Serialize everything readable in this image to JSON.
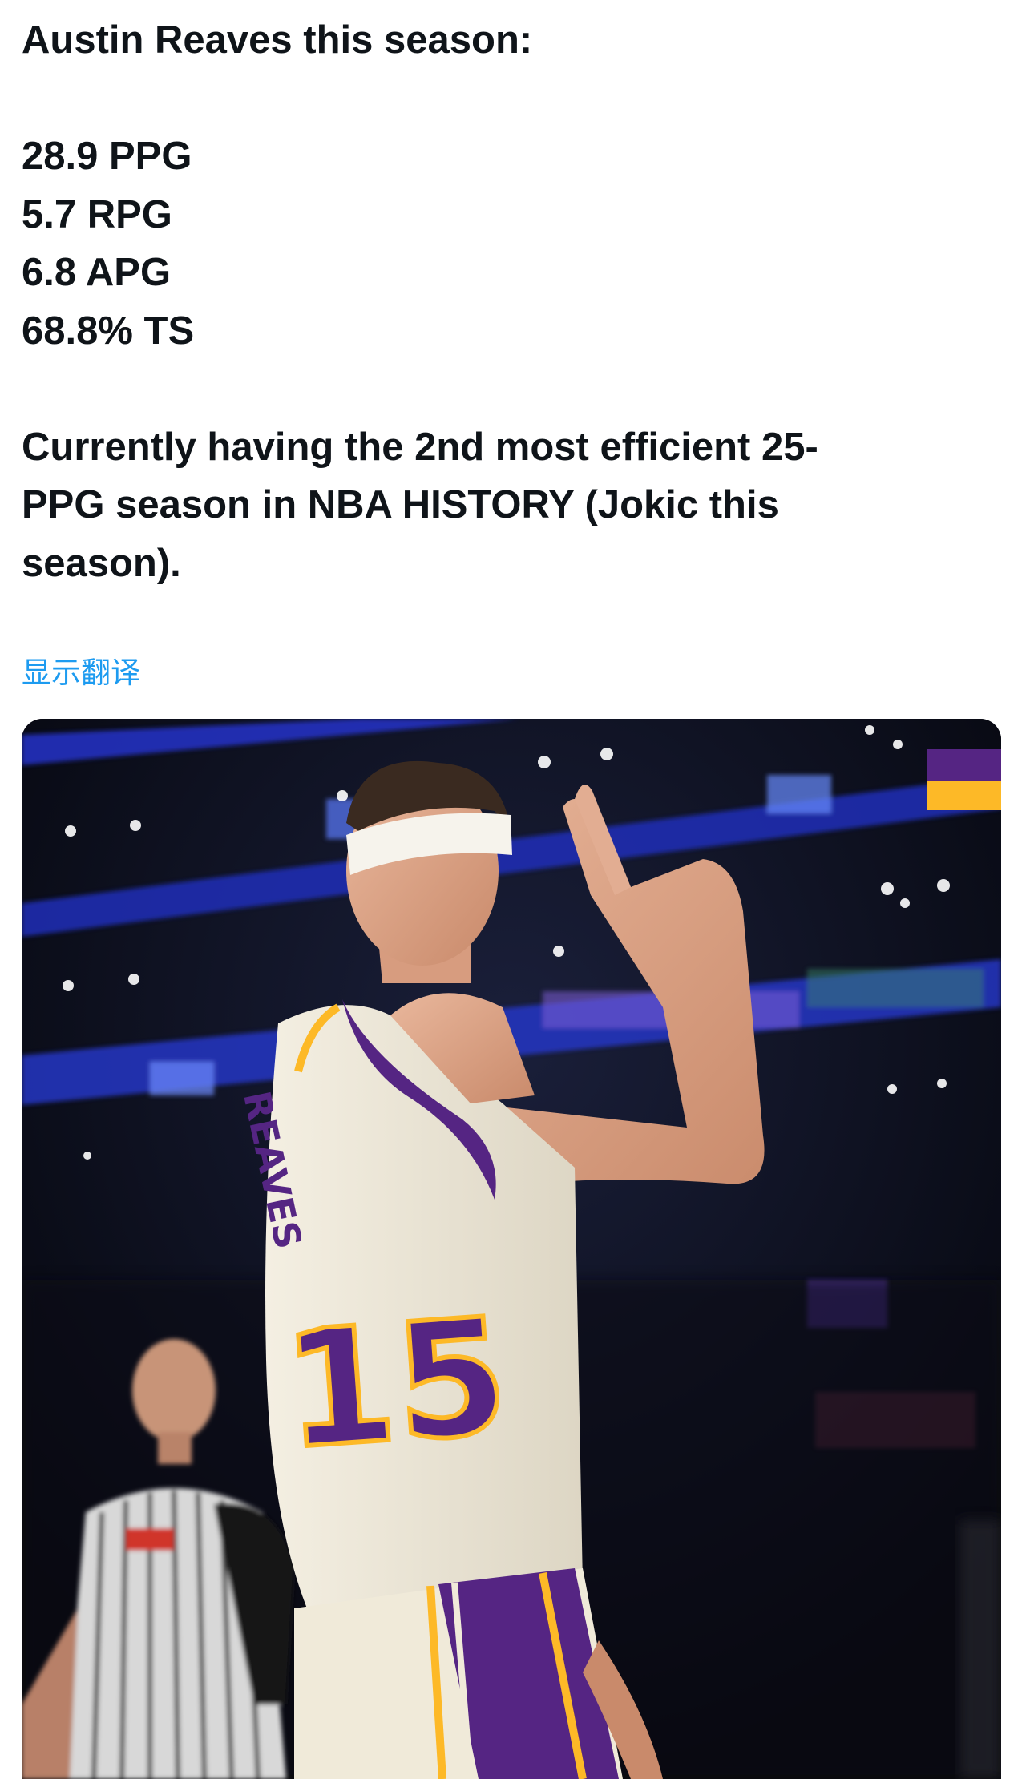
{
  "tweet": {
    "headline": "Austin Reaves this season:",
    "stats": [
      "28.9 PPG",
      "5.7 RPG",
      "6.8 APG",
      "68.8% TS"
    ],
    "body_lines": [
      "Currently having the 2nd most efficient 25-",
      "PPG season in NBA HISTORY (Jokic this",
      "season)."
    ],
    "translate_label": "显示翻译"
  },
  "media": {
    "jersey_number": "15",
    "jersey_name": "REAVES"
  },
  "colors": {
    "link": "#1d9bf0",
    "text": "#0f1419",
    "lakers_purple": "#552583",
    "lakers_gold": "#fdb927"
  },
  "icons": {
    "photo": "tweet-photo"
  }
}
